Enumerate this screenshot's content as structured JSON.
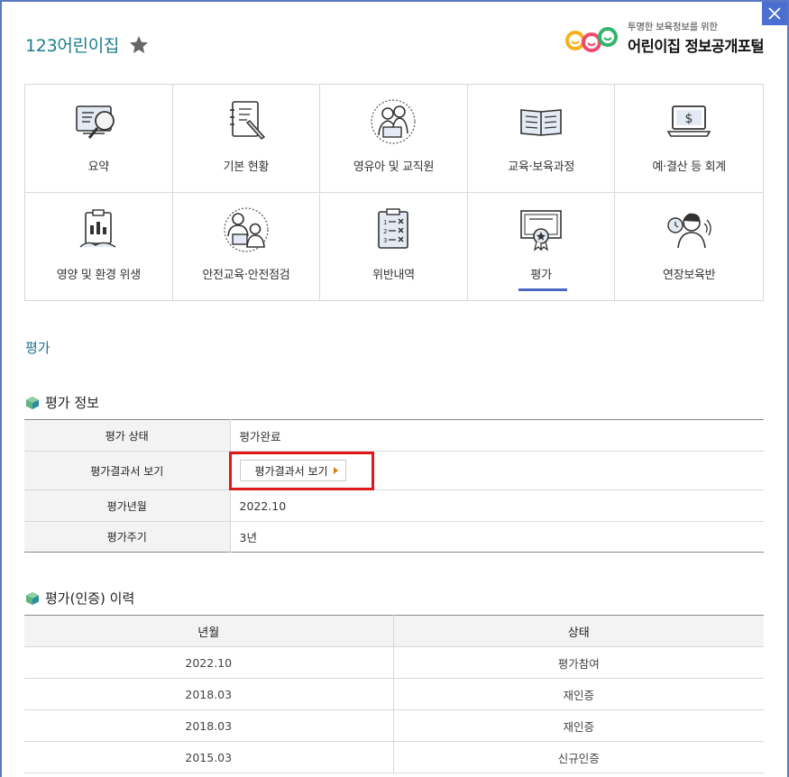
{
  "window": {
    "close_icon": "close-icon"
  },
  "header": {
    "title": "123어린이집",
    "star_icon": "star-icon",
    "logo": {
      "sub": "투명한 보육정보를 위한",
      "main": "어린이집 정보공개포털"
    }
  },
  "menu": {
    "items": [
      {
        "label": "요약",
        "icon": "summary-magnifier-icon"
      },
      {
        "label": "기본 현황",
        "icon": "notepad-pencil-icon"
      },
      {
        "label": "영유아 및 교직원",
        "icon": "teacher-child-icon"
      },
      {
        "label": "교육·보육과정",
        "icon": "open-book-icon"
      },
      {
        "label": "예·결산 등 회계",
        "icon": "laptop-dollar-icon"
      },
      {
        "label": "영양 및 환경 위생",
        "icon": "clipboard-chart-icon"
      },
      {
        "label": "안전교육·안전점검",
        "icon": "safety-meeting-icon"
      },
      {
        "label": "위반내역",
        "icon": "checklist-x-icon"
      },
      {
        "label": "평가",
        "icon": "certificate-icon"
      },
      {
        "label": "연장보육반",
        "icon": "night-care-icon"
      }
    ],
    "active_index": 8
  },
  "section": {
    "title": "평가"
  },
  "eval_info": {
    "heading": "평가 정보",
    "status_label": "평가 상태",
    "status_value": "평가완료",
    "report_label": "평가결과서 보기",
    "report_button": "평가결과서 보기",
    "date_label": "평가년월",
    "date_value": "2022.10",
    "cycle_label": "평가주기",
    "cycle_value": "3년"
  },
  "history": {
    "heading": "평가(인증) 이력",
    "columns": [
      "년월",
      "상태"
    ],
    "rows": [
      [
        "2022.10",
        "평가참여"
      ],
      [
        "2018.03",
        "재인증"
      ],
      [
        "2018.03",
        "재인증"
      ],
      [
        "2015.03",
        "신규인증"
      ]
    ]
  },
  "colors": {
    "accent": "#4b67c6",
    "title": "#1d7d8e",
    "highlight": "#e01818",
    "button_arrow": "#e07a10"
  }
}
